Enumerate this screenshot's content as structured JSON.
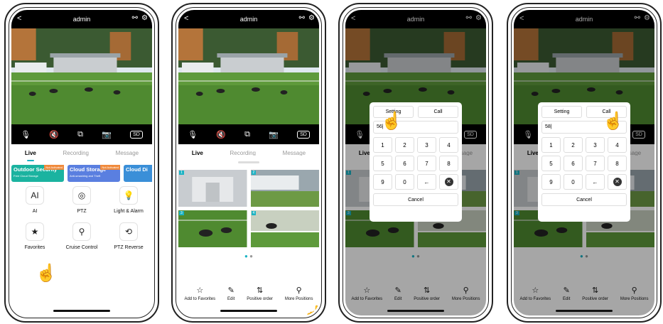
{
  "header": {
    "title": "admin",
    "back": "<",
    "share": "⚯",
    "settings": "⚙"
  },
  "controls": {
    "mic": "🎙",
    "mute": "🔇",
    "record": "⧉",
    "camera": "📷",
    "sd": "SD"
  },
  "tabs": [
    "Live",
    "Recording",
    "Message"
  ],
  "banners": [
    {
      "title": "Outdoor Security",
      "sub": "Free Cloud Storage",
      "tag": "Not Activated",
      "color": "#1bb3a0"
    },
    {
      "title": "Cloud Storage",
      "sub": "Anti-smashing and Theft",
      "tag": "Not Activated",
      "color": "#5a7fe0"
    },
    {
      "title": "Cloud Di",
      "sub": "",
      "tag": "",
      "color": "#3a8fd8"
    }
  ],
  "features": [
    {
      "label": "AI",
      "icon": "AI"
    },
    {
      "label": "PTZ",
      "icon": "◎"
    },
    {
      "label": "Light & Alarm",
      "icon": "💡"
    },
    {
      "label": "Favorites",
      "icon": "★"
    },
    {
      "label": "Cruise Control",
      "icon": "⚲"
    },
    {
      "label": "PTZ Reverse",
      "icon": "⟲"
    }
  ],
  "actions": [
    {
      "label": "Add to Favorites",
      "icon": "☆"
    },
    {
      "label": "Edit",
      "icon": "✎"
    },
    {
      "label": "Positive order",
      "icon": "⇅"
    },
    {
      "label": "More Positions",
      "icon": "⚲"
    }
  ],
  "thumb_numbers": [
    "1",
    "2",
    "3",
    "4"
  ],
  "dialog": {
    "tabs": [
      "Setting",
      "Call"
    ],
    "inputs": [
      "56|",
      "58|"
    ],
    "keys": [
      "1",
      "2",
      "3",
      "4",
      "5",
      "6",
      "7",
      "8",
      "9",
      "0",
      "←",
      "✕"
    ],
    "cancel": "Cancel"
  },
  "colors": {
    "accent": "#1bb3c4",
    "hand": "#f0c040"
  }
}
